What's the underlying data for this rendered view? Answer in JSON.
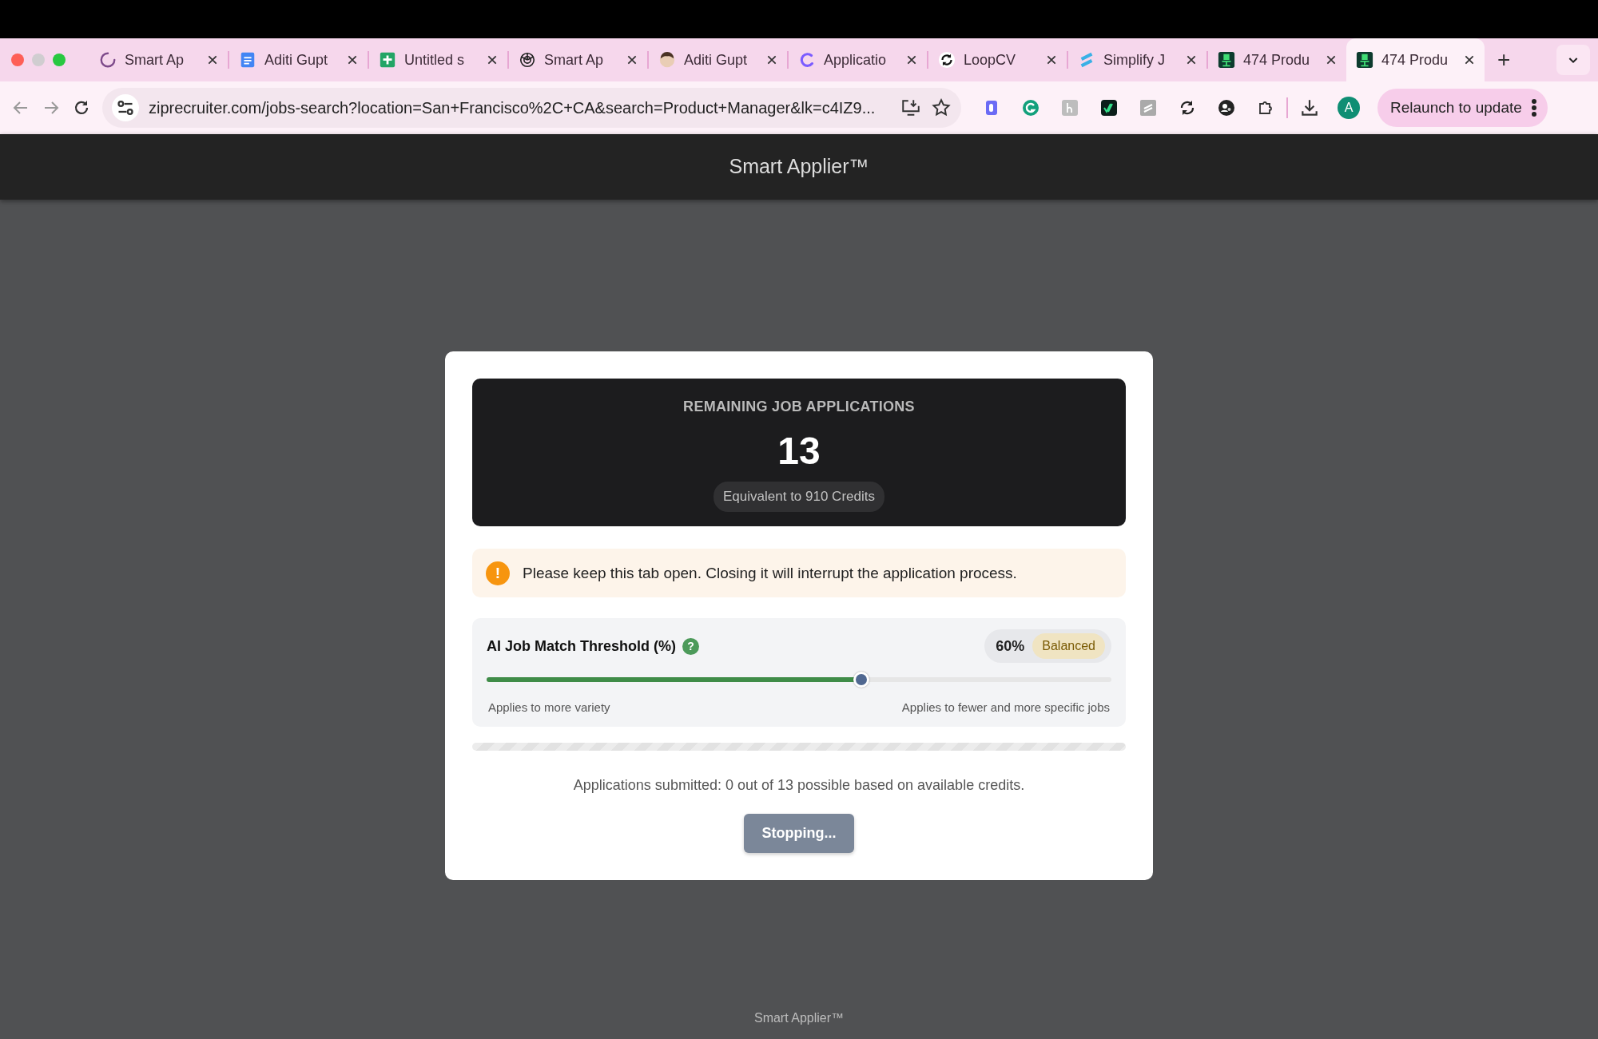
{
  "browser": {
    "tabs": [
      {
        "title": "Smart Ap",
        "loading": true,
        "selected": false
      },
      {
        "title": "Aditi Gupt",
        "loading": false,
        "selected": false
      },
      {
        "title": "Untitled s",
        "loading": false,
        "selected": false
      },
      {
        "title": "Smart Ap",
        "loading": false,
        "selected": false
      },
      {
        "title": "Aditi Gupt",
        "loading": false,
        "selected": false
      },
      {
        "title": "Applicatio",
        "loading": false,
        "selected": false
      },
      {
        "title": "LoopCV",
        "loading": false,
        "selected": false
      },
      {
        "title": "Simplify J",
        "loading": false,
        "selected": false
      },
      {
        "title": "474 Produ",
        "loading": false,
        "selected": false
      },
      {
        "title": "474 Produ",
        "loading": false,
        "selected": true
      }
    ],
    "new_tab": "+",
    "address_bar": {
      "url": "ziprecruiter.com/jobs-search?location=San+Francisco%2C+CA&search=Product+Manager&lk=c4IZ9..."
    },
    "avatar": "A",
    "relaunch_button": "Relaunch to update"
  },
  "app_header": {
    "title": "Smart Applier™"
  },
  "modal": {
    "remaining": {
      "label": "REMAINING JOB APPLICATIONS",
      "count": "13",
      "credits": "Equivalent to 910 Credits"
    },
    "warning": {
      "icon_text": "!",
      "message": "Please keep this tab open. Closing it will interrupt the application process."
    },
    "threshold": {
      "title": "AI Job Match Threshold (%)",
      "help": "?",
      "value": "60%",
      "badge": "Balanced",
      "level": 0.6,
      "left_hint": "Applies to more variety",
      "right_hint": "Applies to fewer and more specific jobs"
    },
    "progress": {
      "level": 0
    },
    "status": "Applications submitted: 0 out of 13 possible based on available credits.",
    "button": {
      "label": "Stopping...",
      "disabled": true
    }
  },
  "footer": "Smart Applier™"
}
